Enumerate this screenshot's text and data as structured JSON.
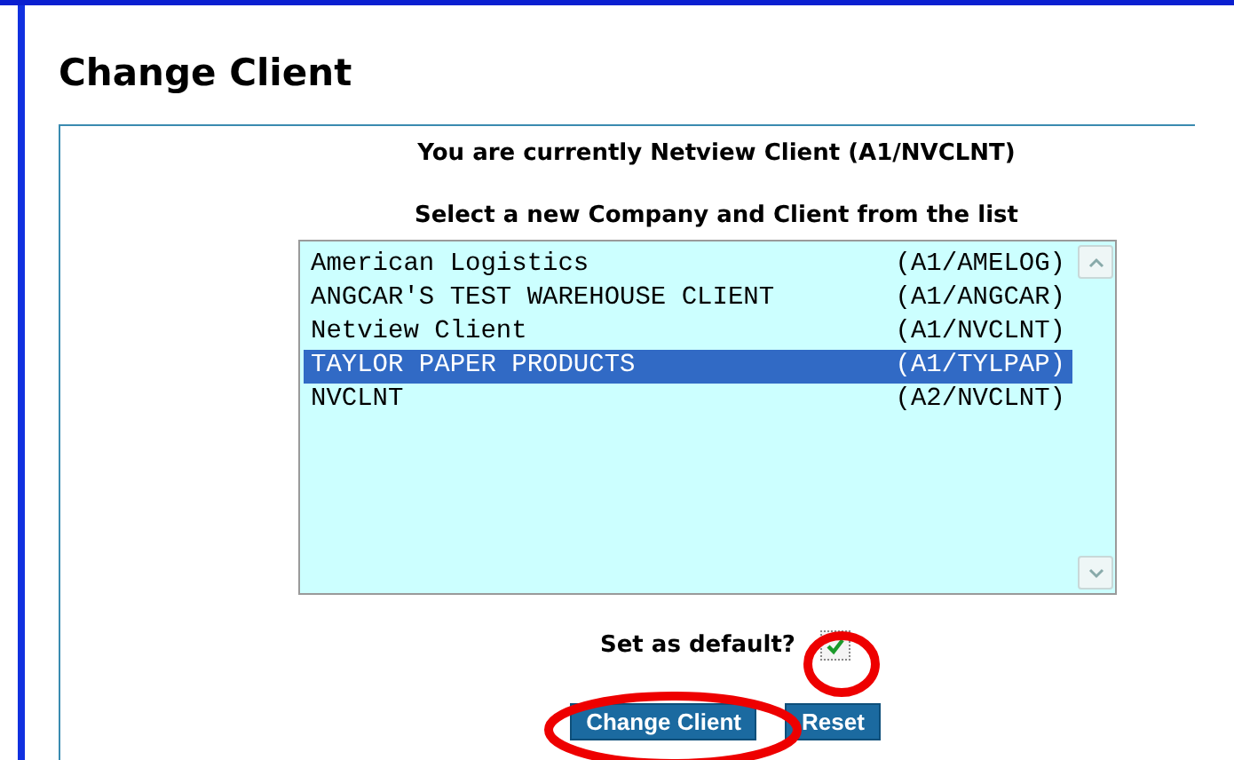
{
  "title": "Change Client",
  "current": "You are currently Netview Client (A1/NVCLNT)",
  "instruction": "Select a new Company and Client from the list",
  "clients": [
    {
      "name": "American Logistics",
      "code": "(A1/AMELOG)",
      "selected": false
    },
    {
      "name": "ANGCAR'S TEST WAREHOUSE CLIENT",
      "code": "(A1/ANGCAR)",
      "selected": false
    },
    {
      "name": "Netview Client",
      "code": "(A1/NVCLNT)",
      "selected": false
    },
    {
      "name": "TAYLOR PAPER PRODUCTS",
      "code": "(A1/TYLPAP)",
      "selected": true
    },
    {
      "name": "NVCLNT",
      "code": "(A2/NVCLNT)",
      "selected": false
    }
  ],
  "default_option": {
    "label": "Set as default?",
    "checked": true
  },
  "buttons": [
    {
      "label": "Change Client"
    },
    {
      "label": "Reset"
    }
  ]
}
